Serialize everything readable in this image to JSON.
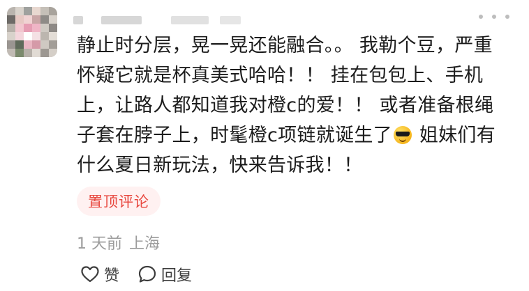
{
  "comment": {
    "lines": [
      "静止时分层，晃一晃还能融合。。 我勒个豆，严重",
      "怀疑它就是杯真美式哈哈！！ 挂在包包上、手机",
      "上，让路人都知道我对橙c的爱！！ 或者准备根绳",
      "子套在脖子上，时髦橙c项链就诞生了",
      "什么夏日新玩法，快来告诉我！！"
    ],
    "line4_after_emoji": " 姐妹们有",
    "emoji": "smiling-face-with-sunglasses"
  },
  "tag": {
    "label": "置顶评论",
    "color": "#e8473e"
  },
  "meta": {
    "time": "1 天前",
    "location": "上海"
  },
  "actions": {
    "like_label": "赞",
    "reply_label": "回复"
  },
  "icons": {
    "like": "heart-icon",
    "reply": "chat-bubble-icon",
    "more": "more-dots-icon"
  }
}
